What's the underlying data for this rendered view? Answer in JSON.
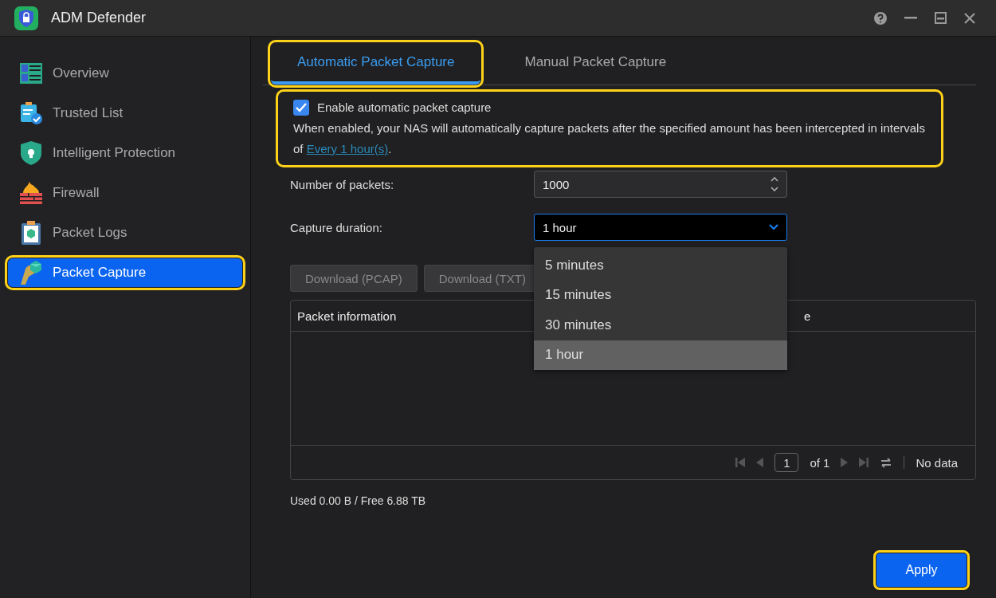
{
  "window": {
    "title": "ADM Defender"
  },
  "sidebar": {
    "items": [
      {
        "label": "Overview",
        "selected": false,
        "highlighted": false
      },
      {
        "label": "Trusted List",
        "selected": false,
        "highlighted": false
      },
      {
        "label": "Intelligent Protection",
        "selected": false,
        "highlighted": false
      },
      {
        "label": "Firewall",
        "selected": false,
        "highlighted": false
      },
      {
        "label": "Packet Logs",
        "selected": false,
        "highlighted": false
      },
      {
        "label": "Packet Capture",
        "selected": true,
        "highlighted": true
      }
    ]
  },
  "tabs": [
    {
      "label": "Automatic Packet Capture",
      "selected": true,
      "highlighted": true
    },
    {
      "label": "Manual Packet Capture",
      "selected": false,
      "highlighted": false
    }
  ],
  "enable": {
    "label": "Enable automatic packet capture",
    "checked": true,
    "description": "When enabled, your NAS will automatically capture packets after the specified amount has been intercepted in intervals of",
    "link": "Every 1 hour(s)",
    "after": ".",
    "highlighted": true
  },
  "packets": {
    "label": "Number of packets:",
    "value": "1000"
  },
  "duration": {
    "label": "Capture duration:",
    "value": "1 hour",
    "expanded": true,
    "options": [
      {
        "label": "5 minutes",
        "selected": false
      },
      {
        "label": "15 minutes",
        "selected": false
      },
      {
        "label": "30 minutes",
        "selected": false
      },
      {
        "label": "1 hour",
        "selected": true
      }
    ]
  },
  "buttons": [
    {
      "label": "Download (PCAP)",
      "disabled": true
    },
    {
      "label": "Download (TXT)",
      "disabled": true
    }
  ],
  "table": {
    "columns": [
      "Packet information",
      "e"
    ],
    "pager": {
      "page": "1",
      "of": "of 1",
      "status": "No data"
    }
  },
  "storage": "Used 0.00 B / Free 6.88 TB",
  "apply": {
    "label": "Apply",
    "highlighted": true
  }
}
